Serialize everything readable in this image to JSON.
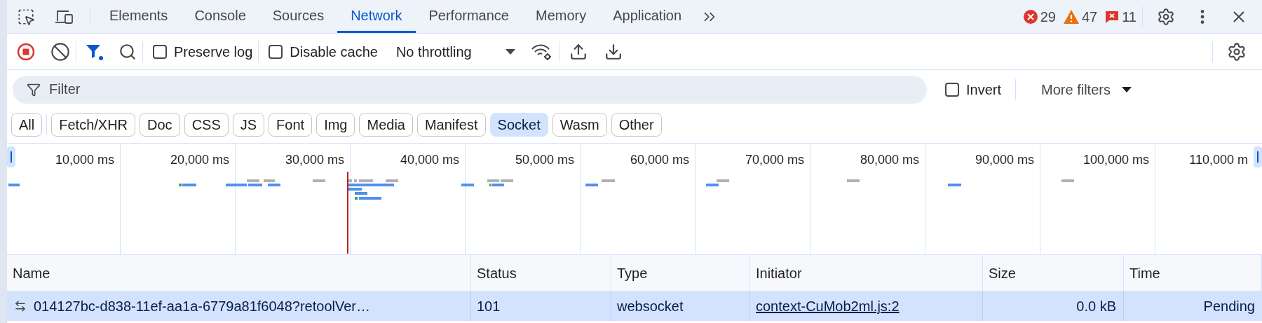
{
  "tabs": [
    {
      "label": "Elements",
      "selected": false
    },
    {
      "label": "Console",
      "selected": false
    },
    {
      "label": "Sources",
      "selected": false
    },
    {
      "label": "Network",
      "selected": true
    },
    {
      "label": "Performance",
      "selected": false
    },
    {
      "label": "Memory",
      "selected": false
    },
    {
      "label": "Application",
      "selected": false
    }
  ],
  "issues": [
    {
      "kind": "error",
      "count": "29"
    },
    {
      "kind": "warning",
      "count": "47"
    },
    {
      "kind": "message",
      "count": "11"
    }
  ],
  "toolbar": {
    "recording": true,
    "preserve_log": {
      "label": "Preserve log",
      "checked": false
    },
    "disable_cache": {
      "label": "Disable cache",
      "checked": false
    },
    "throttling": "No throttling"
  },
  "filter": {
    "placeholder": "Filter",
    "invert": {
      "label": "Invert",
      "checked": false
    },
    "more_filters": "More filters"
  },
  "type_filters": [
    {
      "label": "All",
      "selected": false
    },
    {
      "label": "Fetch/XHR",
      "selected": false
    },
    {
      "label": "Doc",
      "selected": false
    },
    {
      "label": "CSS",
      "selected": false
    },
    {
      "label": "JS",
      "selected": false
    },
    {
      "label": "Font",
      "selected": false
    },
    {
      "label": "Img",
      "selected": false
    },
    {
      "label": "Media",
      "selected": false
    },
    {
      "label": "Manifest",
      "selected": false
    },
    {
      "label": "Socket",
      "selected": true
    },
    {
      "label": "Wasm",
      "selected": false
    },
    {
      "label": "Other",
      "selected": false
    }
  ],
  "timeline": {
    "ticks": [
      "10,000 ms",
      "20,000 ms",
      "30,000 ms",
      "40,000 ms",
      "50,000 ms",
      "60,000 ms",
      "70,000 ms",
      "80,000 ms",
      "90,000 ms",
      "100,000 ms",
      "110,000 m"
    ]
  },
  "table": {
    "columns": [
      "Name",
      "Status",
      "Type",
      "Initiator",
      "Size",
      "Time"
    ],
    "rows": [
      {
        "name": "014127bc-d838-11ef-aa1a-6779a81f6048?retoolVer…",
        "status": "101",
        "type": "websocket",
        "initiator": "context-CuMob2ml.js:2",
        "size": "0.0 kB",
        "time": "Pending",
        "selected": true
      }
    ]
  }
}
